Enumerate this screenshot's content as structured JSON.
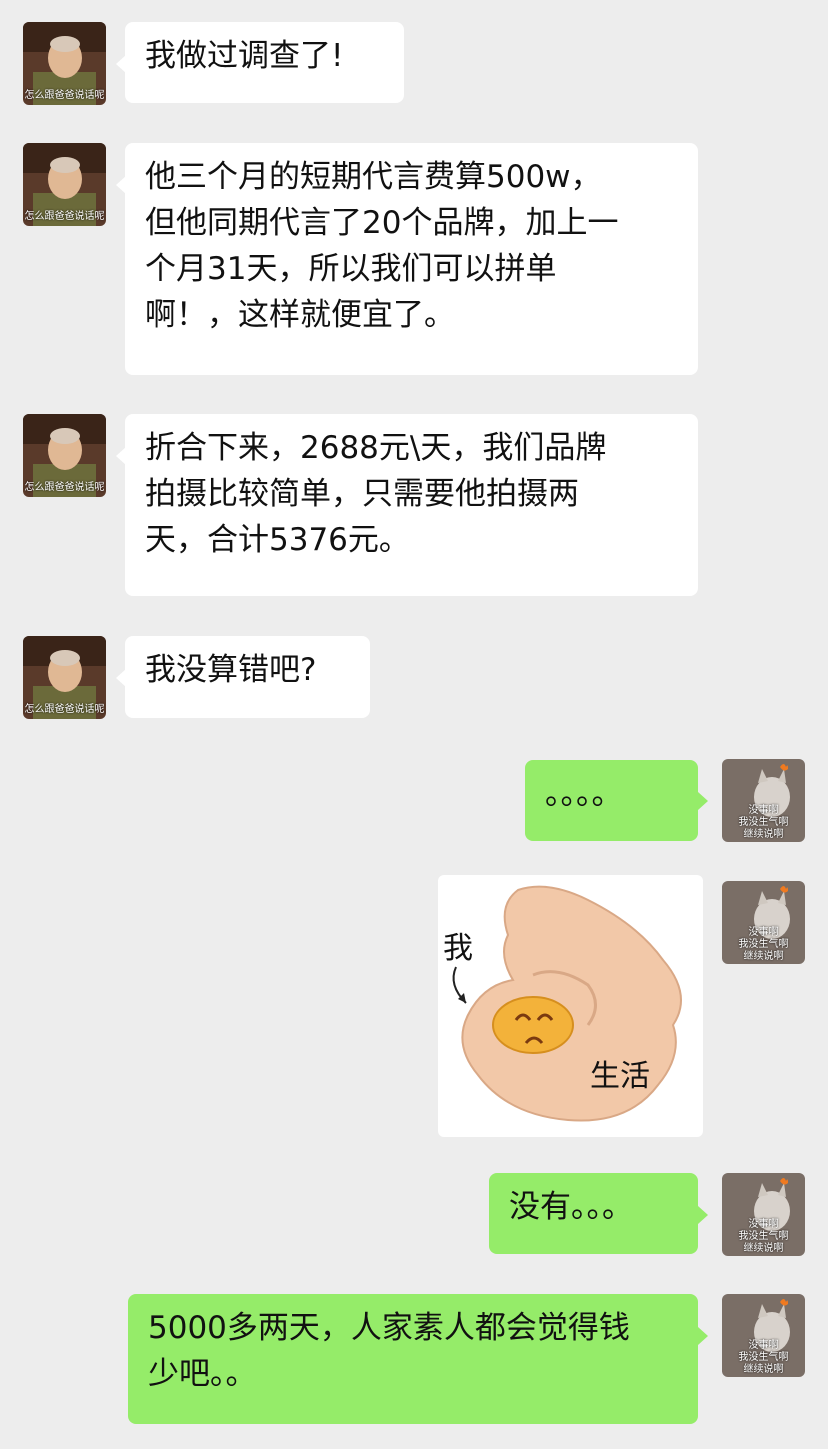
{
  "colors": {
    "background": "#ededed",
    "left_bubble": "#ffffff",
    "right_bubble": "#95ec69"
  },
  "left_avatar": {
    "caption": "怎么跟爸爸说话呢",
    "icon": "person-avatar"
  },
  "right_avatar": {
    "caption_lines": [
      "没事啊",
      "我没生气啊",
      "继续说啊"
    ],
    "icon": "cat-avatar"
  },
  "messages": [
    {
      "side": "left",
      "text": "我做过调查了!"
    },
    {
      "side": "left",
      "text": "他三个月的短期代言费算500w，\n但他同期代言了20个品牌，加上一\n个月31天，所以我们可以拼单\n啊！，这样就便宜了。"
    },
    {
      "side": "left",
      "text": "折合下来，2688元\\天，我们品牌\n拍摄比较简单，只需要他拍摄两\n天，合计5376元。"
    },
    {
      "side": "left",
      "text": "我没算错吧?"
    },
    {
      "side": "right",
      "text": "。。。。"
    },
    {
      "side": "right",
      "type": "sticker",
      "label_me": "我",
      "label_life": "生活"
    },
    {
      "side": "right",
      "text": "没有。。。"
    },
    {
      "side": "right",
      "text": "5000多两天，人家素人都会觉得钱\n少吧。。"
    }
  ]
}
